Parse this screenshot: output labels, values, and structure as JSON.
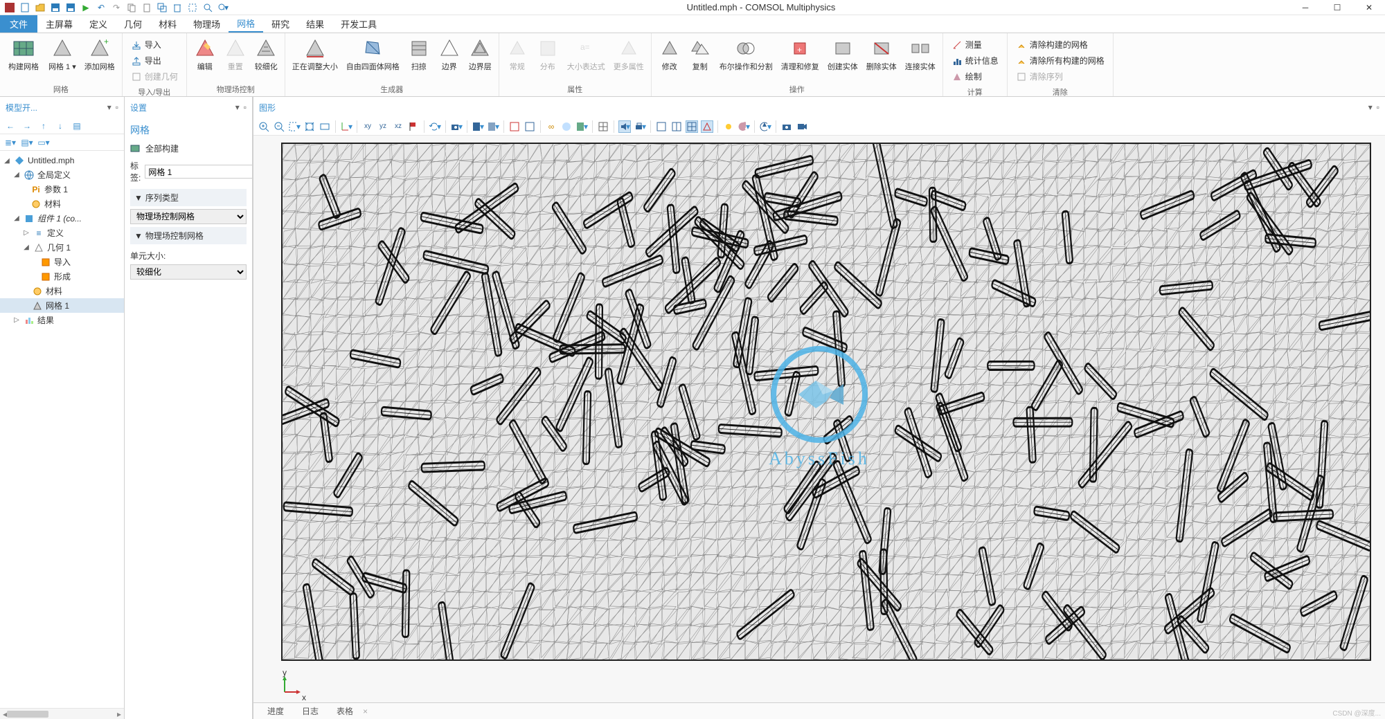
{
  "title": "Untitled.mph - COMSOL Multiphysics",
  "menu": {
    "file": "文件",
    "items": [
      "主屏幕",
      "定义",
      "几何",
      "材料",
      "物理场",
      "网格",
      "研究",
      "结果",
      "开发工具"
    ],
    "active_index": 5
  },
  "ribbon": {
    "g0": {
      "label": "网格",
      "btns": [
        "构建网格",
        "网格 1 ▾",
        "添加网格"
      ]
    },
    "g1": {
      "label": "导入/导出",
      "items": [
        "导入",
        "导出",
        "创建几何"
      ]
    },
    "g2": {
      "label": "物理场控制",
      "btns": [
        "编辑",
        "重置",
        "较细化"
      ]
    },
    "g3": {
      "label": "生成器",
      "btns": [
        "正在调整大小",
        "自由四面体网格",
        "扫掠",
        "边界",
        "边界层"
      ]
    },
    "g4": {
      "label": "属性",
      "btns": [
        "常规",
        "分布",
        "大小表达式",
        "更多属性"
      ]
    },
    "g5": {
      "label": "操作",
      "btns": [
        "修改",
        "复制",
        "布尔操作和分割",
        "清理和修复",
        "创建实体",
        "删除实体",
        "连接实体"
      ]
    },
    "g6": {
      "label": "计算",
      "items": [
        "测量",
        "统计信息",
        "绘制"
      ]
    },
    "g7": {
      "label": "清除",
      "items": [
        "清除构建的网格",
        "清除所有构建的网格",
        "清除序列"
      ]
    }
  },
  "tree_panel": {
    "title": "模型开..."
  },
  "tree": {
    "root": "Untitled.mph",
    "global": "全局定义",
    "params": "参数 1",
    "materials": "材料",
    "comp": "组件 1 (co...",
    "def": "定义",
    "geom": "几何 1",
    "import": "导入",
    "form": "形成",
    "mat2": "材料",
    "mesh": "网格 1",
    "results": "结果"
  },
  "settings": {
    "title": "设置",
    "mesh_head": "网格",
    "build_all": "全部构建",
    "label_lbl": "标签:",
    "label_val": "网格 1",
    "seq_section": "序列类型",
    "seq_val": "物理场控制网格",
    "phys_section": "物理场控制网格",
    "elem_lbl": "单元大小:",
    "elem_val": "较细化"
  },
  "graphics": {
    "title": "图形",
    "watermark": "AbyssFish",
    "axis_x": "x",
    "axis_y": "y"
  },
  "bottom_tabs": [
    "进度",
    "日志",
    "表格"
  ],
  "csdn": "CSDN @深度..."
}
